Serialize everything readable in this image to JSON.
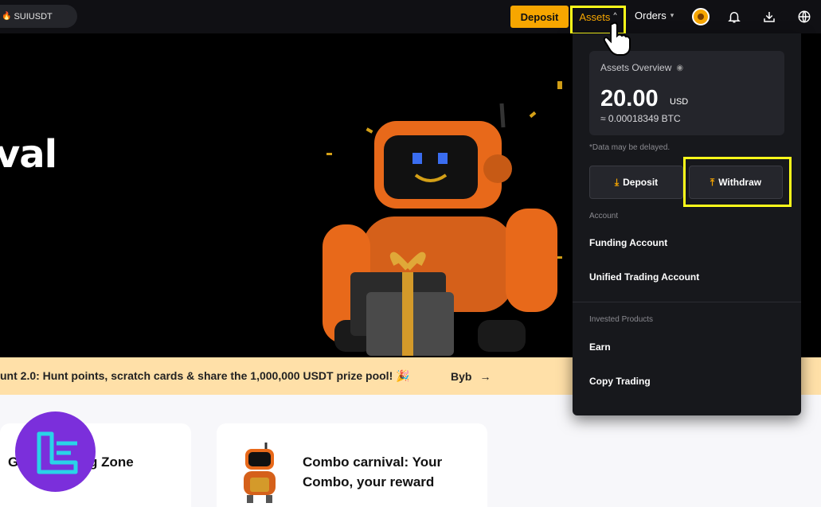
{
  "topbar": {
    "search_pill": "SUIUSDT",
    "deposit_label": "Deposit",
    "assets_label": "Assets",
    "orders_label": "Orders"
  },
  "hero": {
    "title_fragment": "val"
  },
  "banner": {
    "text": "unt 2.0: Hunt points, scratch cards & share the 1,000,000 USDT prize pool! 🎉",
    "more": "Byb",
    "arrow": "→"
  },
  "cards": [
    {
      "title": "G...ve Trading Zone"
    },
    {
      "title": "Combo carnival: Your Combo, your reward"
    }
  ],
  "dropdown": {
    "overview_label": "Assets Overview",
    "amount": "20.00",
    "currency": "USD",
    "btc_equiv": "≈ 0.00018349 BTC",
    "delay_note": "*Data may be delayed.",
    "deposit_label": "Deposit",
    "withdraw_label": "Withdraw",
    "account_section": "Account",
    "account_items": [
      "Funding Account",
      "Unified Trading Account"
    ],
    "invested_section": "Invested Products",
    "invested_items": [
      "Earn",
      "Copy Trading"
    ]
  },
  "colors": {
    "accent": "#f7a600",
    "highlight": "#ffff1a",
    "watermark": "#7b2fdb"
  }
}
